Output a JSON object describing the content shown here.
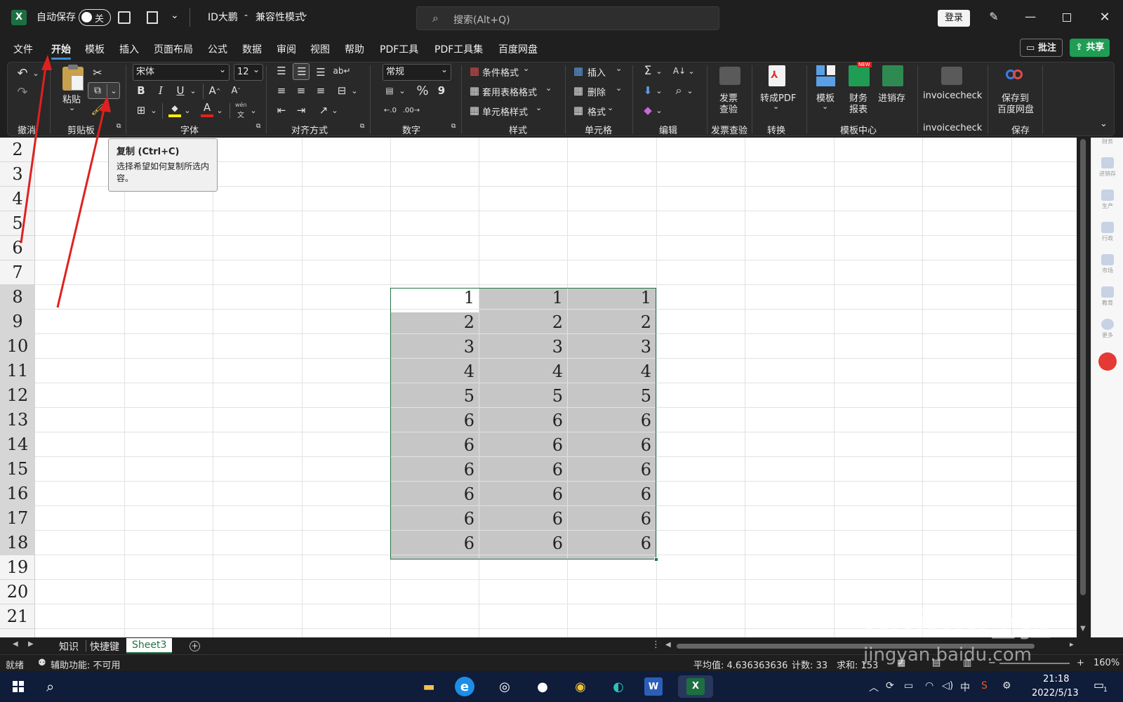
{
  "titlebar": {
    "autosave_label": "自动保存",
    "toggle_state": "关",
    "filename": "ID大鹏",
    "mode": "兼容性模式",
    "search_placeholder": "搜索(Alt+Q)",
    "login": "登录"
  },
  "menu": {
    "items": [
      "文件",
      "开始",
      "模板",
      "插入",
      "页面布局",
      "公式",
      "数据",
      "审阅",
      "视图",
      "帮助",
      "PDF工具",
      "PDF工具集",
      "百度网盘"
    ],
    "active": "开始",
    "comments_btn": "批注",
    "share_btn": "共享"
  },
  "ribbon": {
    "groups": {
      "undo": "撤消",
      "clipboard": "剪贴板",
      "font": "字体",
      "alignment": "对齐方式",
      "number": "数字",
      "styles": "样式",
      "cells": "单元格",
      "editing": "编辑",
      "invoice": "发票查验",
      "convert": "转换",
      "templates": "模板中心",
      "invoicecheck": "invoicecheck",
      "save": "保存"
    },
    "paste": "粘贴",
    "font_name": "宋体",
    "font_size": "12",
    "number_format": "常规",
    "conditional_format": "条件格式",
    "table_format": "套用表格格式",
    "cell_style": "单元格样式",
    "insert": "插入",
    "delete": "删除",
    "format": "格式",
    "invoice_check": [
      "发票",
      "查验"
    ],
    "to_pdf": "转成PDF",
    "template": "模板",
    "finance": [
      "财务",
      "报表"
    ],
    "inventory": "进销存",
    "invoicecheck": "invoicecheck",
    "save_baidu": [
      "保存到",
      "百度网盘"
    ],
    "new_badge": "NEW",
    "percent": "%",
    "comma": "9",
    "wen": "wén",
    "wen2": "文"
  },
  "tooltip": {
    "title": "复制 (Ctrl+C)",
    "body": "选择希望如何复制所选内容。"
  },
  "rows": [
    "2",
    "3",
    "4",
    "5",
    "6",
    "7",
    "8",
    "9",
    "10",
    "11",
    "12",
    "13",
    "14",
    "15",
    "16",
    "17",
    "18",
    "19",
    "20",
    "21"
  ],
  "cells": [
    [
      "1",
      "1",
      "1"
    ],
    [
      "2",
      "2",
      "2"
    ],
    [
      "3",
      "3",
      "3"
    ],
    [
      "4",
      "4",
      "4"
    ],
    [
      "5",
      "5",
      "5"
    ],
    [
      "6",
      "6",
      "6"
    ],
    [
      "6",
      "6",
      "6"
    ],
    [
      "6",
      "6",
      "6"
    ],
    [
      "6",
      "6",
      "6"
    ],
    [
      "6",
      "6",
      "6"
    ],
    [
      "6",
      "6",
      "6"
    ]
  ],
  "sidepanel": [
    "财务",
    "进销存",
    "生产",
    "行政",
    "市场",
    "教育",
    "更多"
  ],
  "sheets": [
    "知识",
    "快捷键",
    "Sheet3"
  ],
  "active_sheet": "Sheet3",
  "status": {
    "ready": "就绪",
    "accessibility": "辅助功能: 不可用",
    "average": "平均值: 4.636363636",
    "count": "计数: 33",
    "sum": "求和: 153",
    "zoom": "160%"
  },
  "taskbar": {
    "lang": "中",
    "time": "21:18",
    "date": "2022/5/13",
    "notif": "1"
  },
  "watermark": {
    "brand": "Baidu经验",
    "url": "jingyan.baidu.com"
  },
  "colors": {
    "excel_green": "#217346",
    "share_green": "#1f9d55",
    "arrow_red": "#e02020",
    "selection_gray": "#c6c6c6"
  }
}
